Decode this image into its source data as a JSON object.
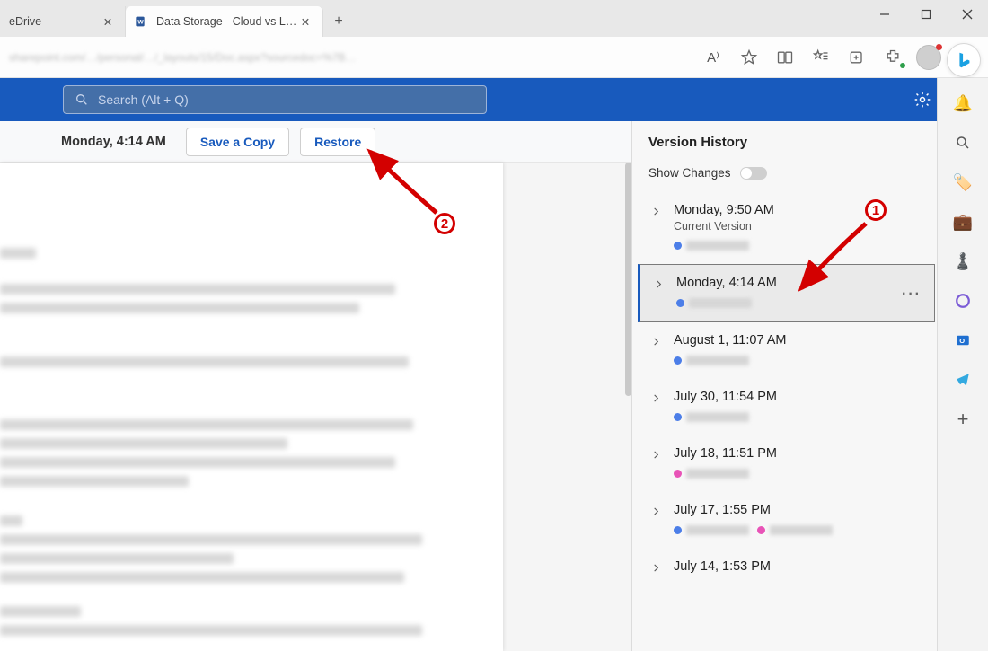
{
  "browser": {
    "tabs": [
      {
        "label": "eDrive",
        "icon": "onedrive"
      },
      {
        "label": "Data Storage - Cloud vs Local.do…",
        "icon": "word"
      }
    ],
    "window_controls": {
      "min": "—",
      "max": "▢",
      "close": "✕"
    },
    "new_tab": "+",
    "address": "sharepoint.com/…/personal/…/_layouts/15/Doc.aspx?sourcedoc=%7B…",
    "toolbar": {
      "read_aloud": "A⁾",
      "favorite": "☆",
      "collections": "⧉",
      "fav_bar": "✩≡",
      "extensions": "⊞",
      "shopping": "🏷",
      "account": "avatar",
      "menu": "⋯"
    }
  },
  "app_header": {
    "search_placeholder": "Search (Alt + Q)",
    "settings": "⚙",
    "avatar": "user"
  },
  "action_bar": {
    "timestamp": "Monday, 4:14 AM",
    "save_copy_label": "Save a Copy",
    "restore_label": "Restore"
  },
  "version_history": {
    "title": "Version History",
    "show_changes_label": "Show Changes",
    "show_changes_on": false,
    "items": [
      {
        "time": "Monday, 9:50 AM",
        "sub": "Current Version",
        "dots": [
          "#4c7ee8"
        ],
        "selected": false
      },
      {
        "time": "Monday, 4:14 AM",
        "sub": "",
        "dots": [
          "#4c7ee8"
        ],
        "selected": true
      },
      {
        "time": "August 1, 11:07 AM",
        "sub": "",
        "dots": [
          "#4c7ee8"
        ],
        "selected": false
      },
      {
        "time": "July 30, 11:54 PM",
        "sub": "",
        "dots": [
          "#4c7ee8"
        ],
        "selected": false
      },
      {
        "time": "July 18, 11:51 PM",
        "sub": "",
        "dots": [
          "#e853b7"
        ],
        "selected": false
      },
      {
        "time": "July 17, 1:55 PM",
        "sub": "",
        "dots": [
          "#4c7ee8",
          "#e853b7"
        ],
        "selected": false
      },
      {
        "time": "July 14, 1:53 PM",
        "sub": "",
        "dots": [],
        "selected": false
      }
    ],
    "more_label": "···"
  },
  "annotations": {
    "n1": "1",
    "n2": "2"
  },
  "edge_sidebar": {
    "items": [
      "bell",
      "search",
      "tag",
      "briefcase",
      "chess",
      "office",
      "outlook",
      "telegram",
      "plus"
    ]
  }
}
